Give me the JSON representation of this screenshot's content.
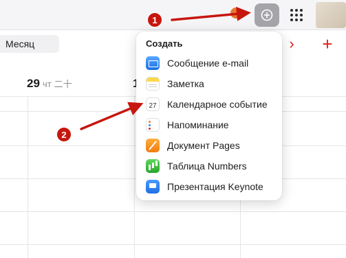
{
  "header": {
    "notification_color": "#e8772e",
    "create_icon": "plus-circle-icon",
    "apps_icon": "apps-grid-icon"
  },
  "toolbar": {
    "view_label": "Месяц",
    "next_icon": "›",
    "add_icon": "+"
  },
  "calendar": {
    "day_number": "29",
    "weekday": "чт",
    "chinese_date": "二十",
    "next_day_number": "1"
  },
  "create_menu": {
    "title": "Создать",
    "items": [
      {
        "label": "Сообщение e-mail",
        "icon": "mail-icon"
      },
      {
        "label": "Заметка",
        "icon": "notes-icon"
      },
      {
        "label": "Календарное событие",
        "icon": "calendar-icon",
        "icon_text": "27"
      },
      {
        "label": "Напоминание",
        "icon": "reminders-icon"
      },
      {
        "label": "Документ Pages",
        "icon": "pages-icon"
      },
      {
        "label": "Таблица Numbers",
        "icon": "numbers-icon"
      },
      {
        "label": "Презентация Keynote",
        "icon": "keynote-icon"
      }
    ]
  },
  "annotations": {
    "badge_1": "1",
    "badge_2": "2",
    "arrow_color": "#c7160e"
  },
  "colors": {
    "accent_red": "#e0211b",
    "active_button": "#a5a5a9"
  }
}
